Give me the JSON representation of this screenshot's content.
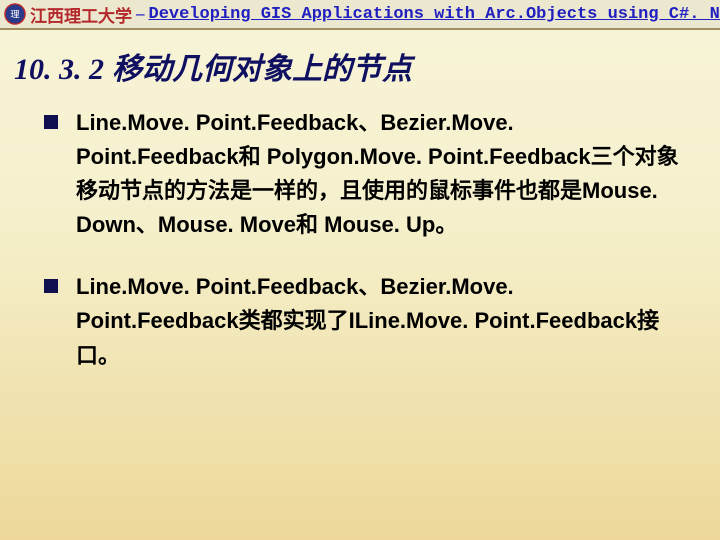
{
  "header": {
    "org": "江西理工大学",
    "dash": "–",
    "subtitle": "Developing GIS Applications with Arc.Objects using C#. NE"
  },
  "title": {
    "number": "10. 3. 2",
    "text": "移动几何对象上的节点"
  },
  "bullets": [
    "Line.Move. Point.Feedback、Bezier.Move. Point.Feedback和 Polygon.Move. Point.Feedback三个对象移动节点的方法是一样的，且使用的鼠标事件也都是Mouse. Down、Mouse. Move和 Mouse. Up。",
    "Line.Move. Point.Feedback、Bezier.Move. Point.Feedback类都实现了ILine.Move. Point.Feedback接口。"
  ]
}
